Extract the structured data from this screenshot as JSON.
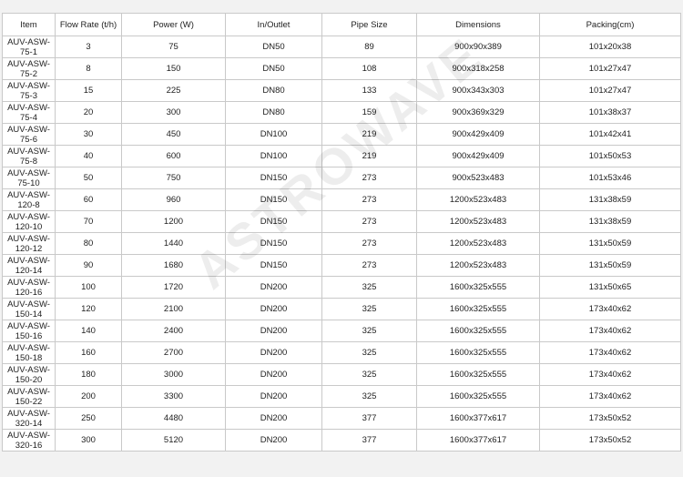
{
  "table": {
    "headers": [
      "Item",
      "Flow Rate (t/h)",
      "Power (W)",
      "In/Outlet",
      "Pipe Size",
      "Dimensions",
      "Packing(cm)"
    ],
    "rows": [
      [
        "AUV-ASW-75-1",
        "3",
        "75",
        "DN50",
        "89",
        "900x90x389",
        "101x20x38"
      ],
      [
        "AUV-ASW-75-2",
        "8",
        "150",
        "DN50",
        "108",
        "900x318x258",
        "101x27x47"
      ],
      [
        "AUV-ASW-75-3",
        "15",
        "225",
        "DN80",
        "133",
        "900x343x303",
        "101x27x47"
      ],
      [
        "AUV-ASW-75-4",
        "20",
        "300",
        "DN80",
        "159",
        "900x369x329",
        "101x38x37"
      ],
      [
        "AUV-ASW-75-6",
        "30",
        "450",
        "DN100",
        "219",
        "900x429x409",
        "101x42x41"
      ],
      [
        "AUV-ASW-75-8",
        "40",
        "600",
        "DN100",
        "219",
        "900x429x409",
        "101x50x53"
      ],
      [
        "AUV-ASW-75-10",
        "50",
        "750",
        "DN150",
        "273",
        "900x523x483",
        "101x53x46"
      ],
      [
        "AUV-ASW-120-8",
        "60",
        "960",
        "DN150",
        "273",
        "1200x523x483",
        "131x38x59"
      ],
      [
        "AUV-ASW-120-10",
        "70",
        "1200",
        "DN150",
        "273",
        "1200x523x483",
        "131x38x59"
      ],
      [
        "AUV-ASW-120-12",
        "80",
        "1440",
        "DN150",
        "273",
        "1200x523x483",
        "131x50x59"
      ],
      [
        "AUV-ASW-120-14",
        "90",
        "1680",
        "DN150",
        "273",
        "1200x523x483",
        "131x50x59"
      ],
      [
        "AUV-ASW-120-16",
        "100",
        "1720",
        "DN200",
        "325",
        "1600x325x555",
        "131x50x65"
      ],
      [
        "AUV-ASW-150-14",
        "120",
        "2100",
        "DN200",
        "325",
        "1600x325x555",
        "173x40x62"
      ],
      [
        "AUV-ASW-150-16",
        "140",
        "2400",
        "DN200",
        "325",
        "1600x325x555",
        "173x40x62"
      ],
      [
        "AUV-ASW-150-18",
        "160",
        "2700",
        "DN200",
        "325",
        "1600x325x555",
        "173x40x62"
      ],
      [
        "AUV-ASW-150-20",
        "180",
        "3000",
        "DN200",
        "325",
        "1600x325x555",
        "173x40x62"
      ],
      [
        "AUV-ASW-150-22",
        "200",
        "3300",
        "DN200",
        "325",
        "1600x325x555",
        "173x40x62"
      ],
      [
        "AUV-ASW-320-14",
        "250",
        "4480",
        "DN200",
        "377",
        "1600x377x617",
        "173x50x52"
      ],
      [
        "AUV-ASW-320-16",
        "300",
        "5120",
        "DN200",
        "377",
        "1600x377x617",
        "173x50x52"
      ]
    ]
  },
  "watermark": "ASTROWAVE"
}
